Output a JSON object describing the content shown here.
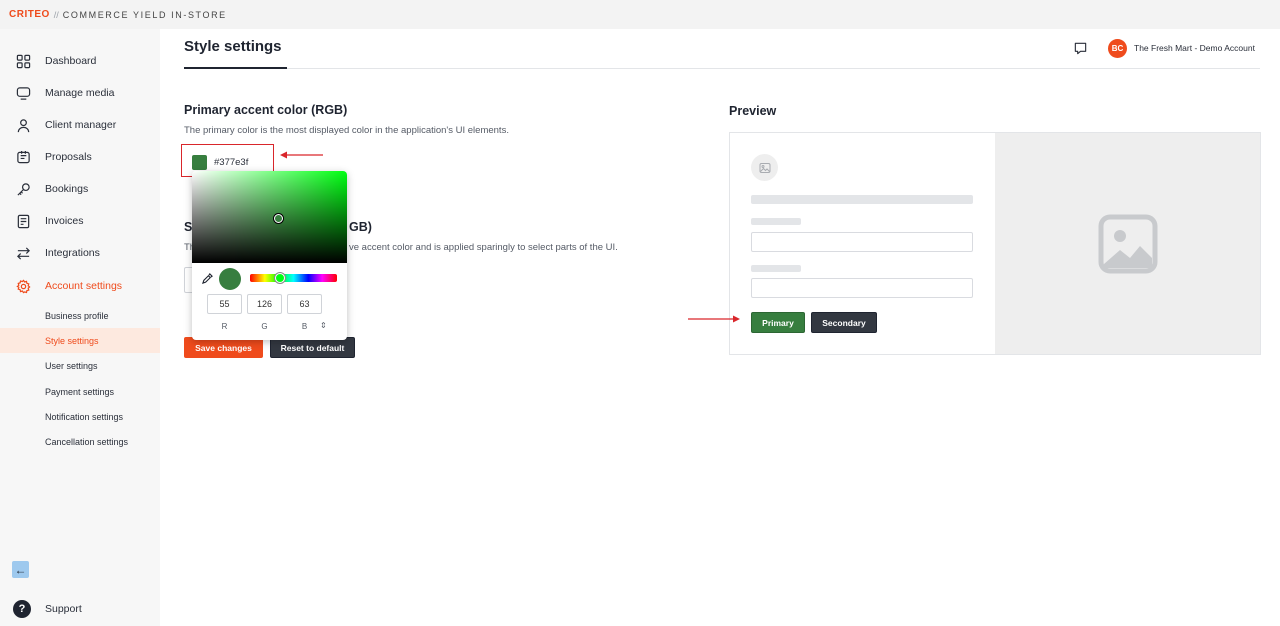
{
  "topbar": {
    "brand": "CRITEO",
    "separator": "//",
    "product": "COMMERCE YIELD IN-STORE"
  },
  "sidebar": {
    "items": [
      {
        "label": "Dashboard",
        "icon": "dashboard-icon"
      },
      {
        "label": "Manage media",
        "icon": "monitor-icon"
      },
      {
        "label": "Client manager",
        "icon": "user-icon"
      },
      {
        "label": "Proposals",
        "icon": "proposal-icon"
      },
      {
        "label": "Bookings",
        "icon": "key-icon"
      },
      {
        "label": "Invoices",
        "icon": "invoice-icon"
      },
      {
        "label": "Integrations",
        "icon": "arrows-icon"
      },
      {
        "label": "Account settings",
        "icon": "gear-icon"
      }
    ],
    "subitems": [
      {
        "label": "Business profile"
      },
      {
        "label": "Style settings"
      },
      {
        "label": "User settings"
      },
      {
        "label": "Payment settings"
      },
      {
        "label": "Notification settings"
      },
      {
        "label": "Cancellation settings"
      }
    ],
    "support_label": "Support"
  },
  "header": {
    "title": "Style settings",
    "avatar_initials": "BC",
    "account_name": "The Fresh Mart - Demo Account"
  },
  "primary": {
    "title": "Primary accent color (RGB)",
    "description": "The primary color is the most displayed color in the application's UI elements.",
    "hex": "#377e3f"
  },
  "secondary": {
    "title_fragment_left": "S",
    "title_fragment_right": "GB)",
    "description_fragment_left": "Th",
    "description_fragment_right": "ve accent color and is applied sparingly to select parts of the UI."
  },
  "picker": {
    "r": "55",
    "g": "126",
    "b": "63",
    "r_label": "R",
    "g_label": "G",
    "b_label": "B",
    "toggle": "⇕",
    "hue_fraction": 0.35
  },
  "buttons": {
    "save": "Save changes",
    "reset": "Reset to default"
  },
  "preview": {
    "title": "Preview",
    "primary_button": "Primary",
    "secondary_button": "Secondary"
  },
  "colors": {
    "accent": "#ef4b1c",
    "primary_selected": "#377e3f",
    "secondary": "#333841",
    "annotation_red": "#d9262b"
  }
}
